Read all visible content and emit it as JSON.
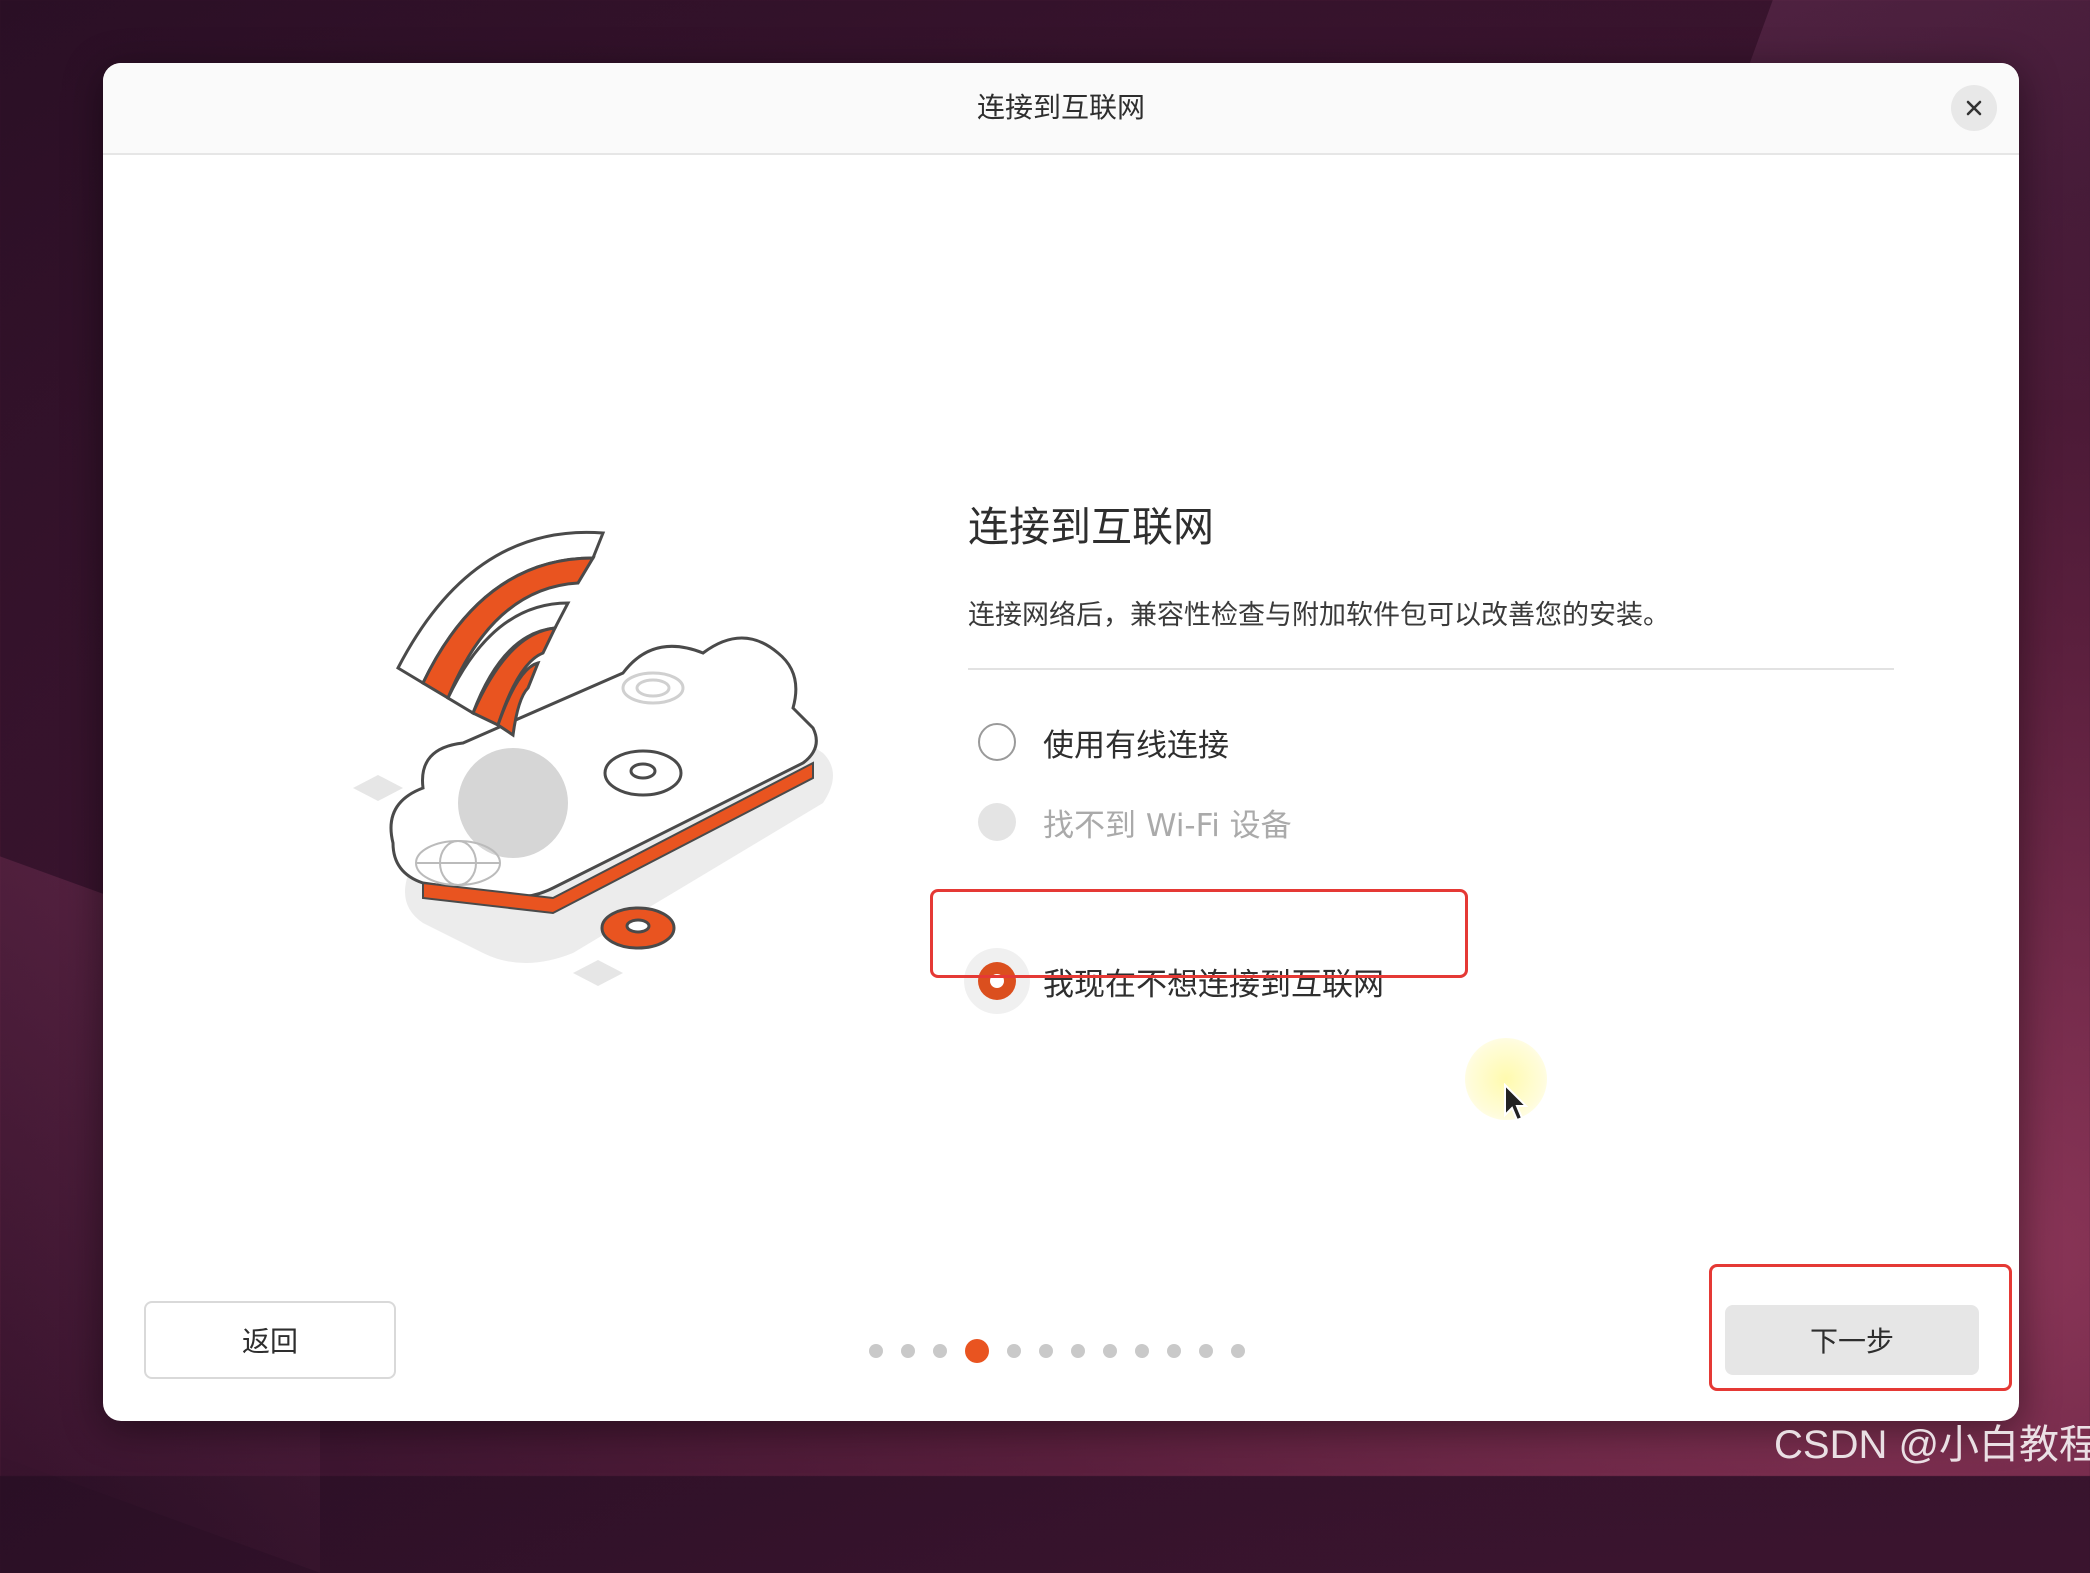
{
  "window": {
    "title": "连接到互联网",
    "close_icon": "close-icon"
  },
  "content": {
    "heading": "连接到互联网",
    "description": "连接网络后，兼容性检查与附加软件包可以改善您的安装。",
    "options": [
      {
        "label": "使用有线连接",
        "state": "unchecked"
      },
      {
        "label": "找不到 Wi-Fi 设备",
        "state": "disabled"
      },
      {
        "label": "我现在不想连接到互联网",
        "state": "checked"
      }
    ]
  },
  "footer": {
    "back_label": "返回",
    "next_label": "下一步",
    "progress": {
      "total_steps": 12,
      "current_step": 4
    }
  },
  "watermark": "CSDN @小白教程",
  "colors": {
    "accent": "#e95420",
    "annotation": "#e53935"
  }
}
